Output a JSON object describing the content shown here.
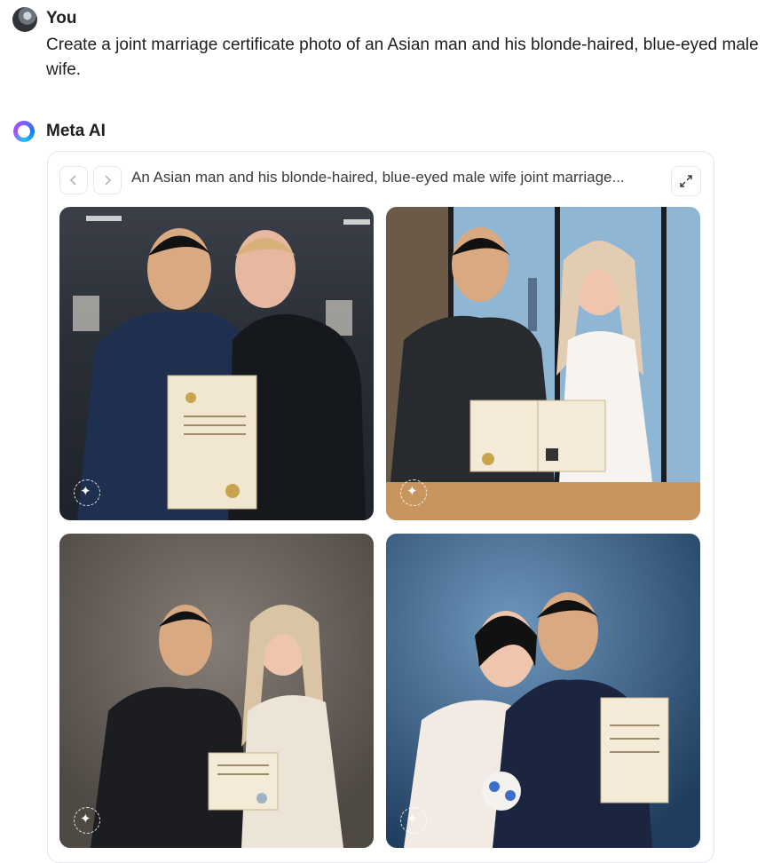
{
  "user": {
    "name": "You",
    "message": "Create a joint marriage certificate photo of an Asian man and his blonde-haired, blue-eyed male wife."
  },
  "assistant": {
    "name": "Meta AI",
    "caption": "An Asian man and his blonde-haired, blue-eyed male wife joint marriage..."
  },
  "images": [
    {
      "alt": "Two men in suits holding a marriage certificate in an office"
    },
    {
      "alt": "Man in suit and blonde woman in white dress holding an open certificate by a city window"
    },
    {
      "alt": "Man in black suit and blonde woman in cream suit holding a certificate"
    },
    {
      "alt": "Bride with bouquet and groom holding a certificate against a blue backdrop"
    }
  ],
  "icons": {
    "prev": "chevron-left-icon",
    "next": "chevron-right-icon",
    "expand": "expand-icon",
    "watermark": "imagined-with-ai-icon"
  }
}
